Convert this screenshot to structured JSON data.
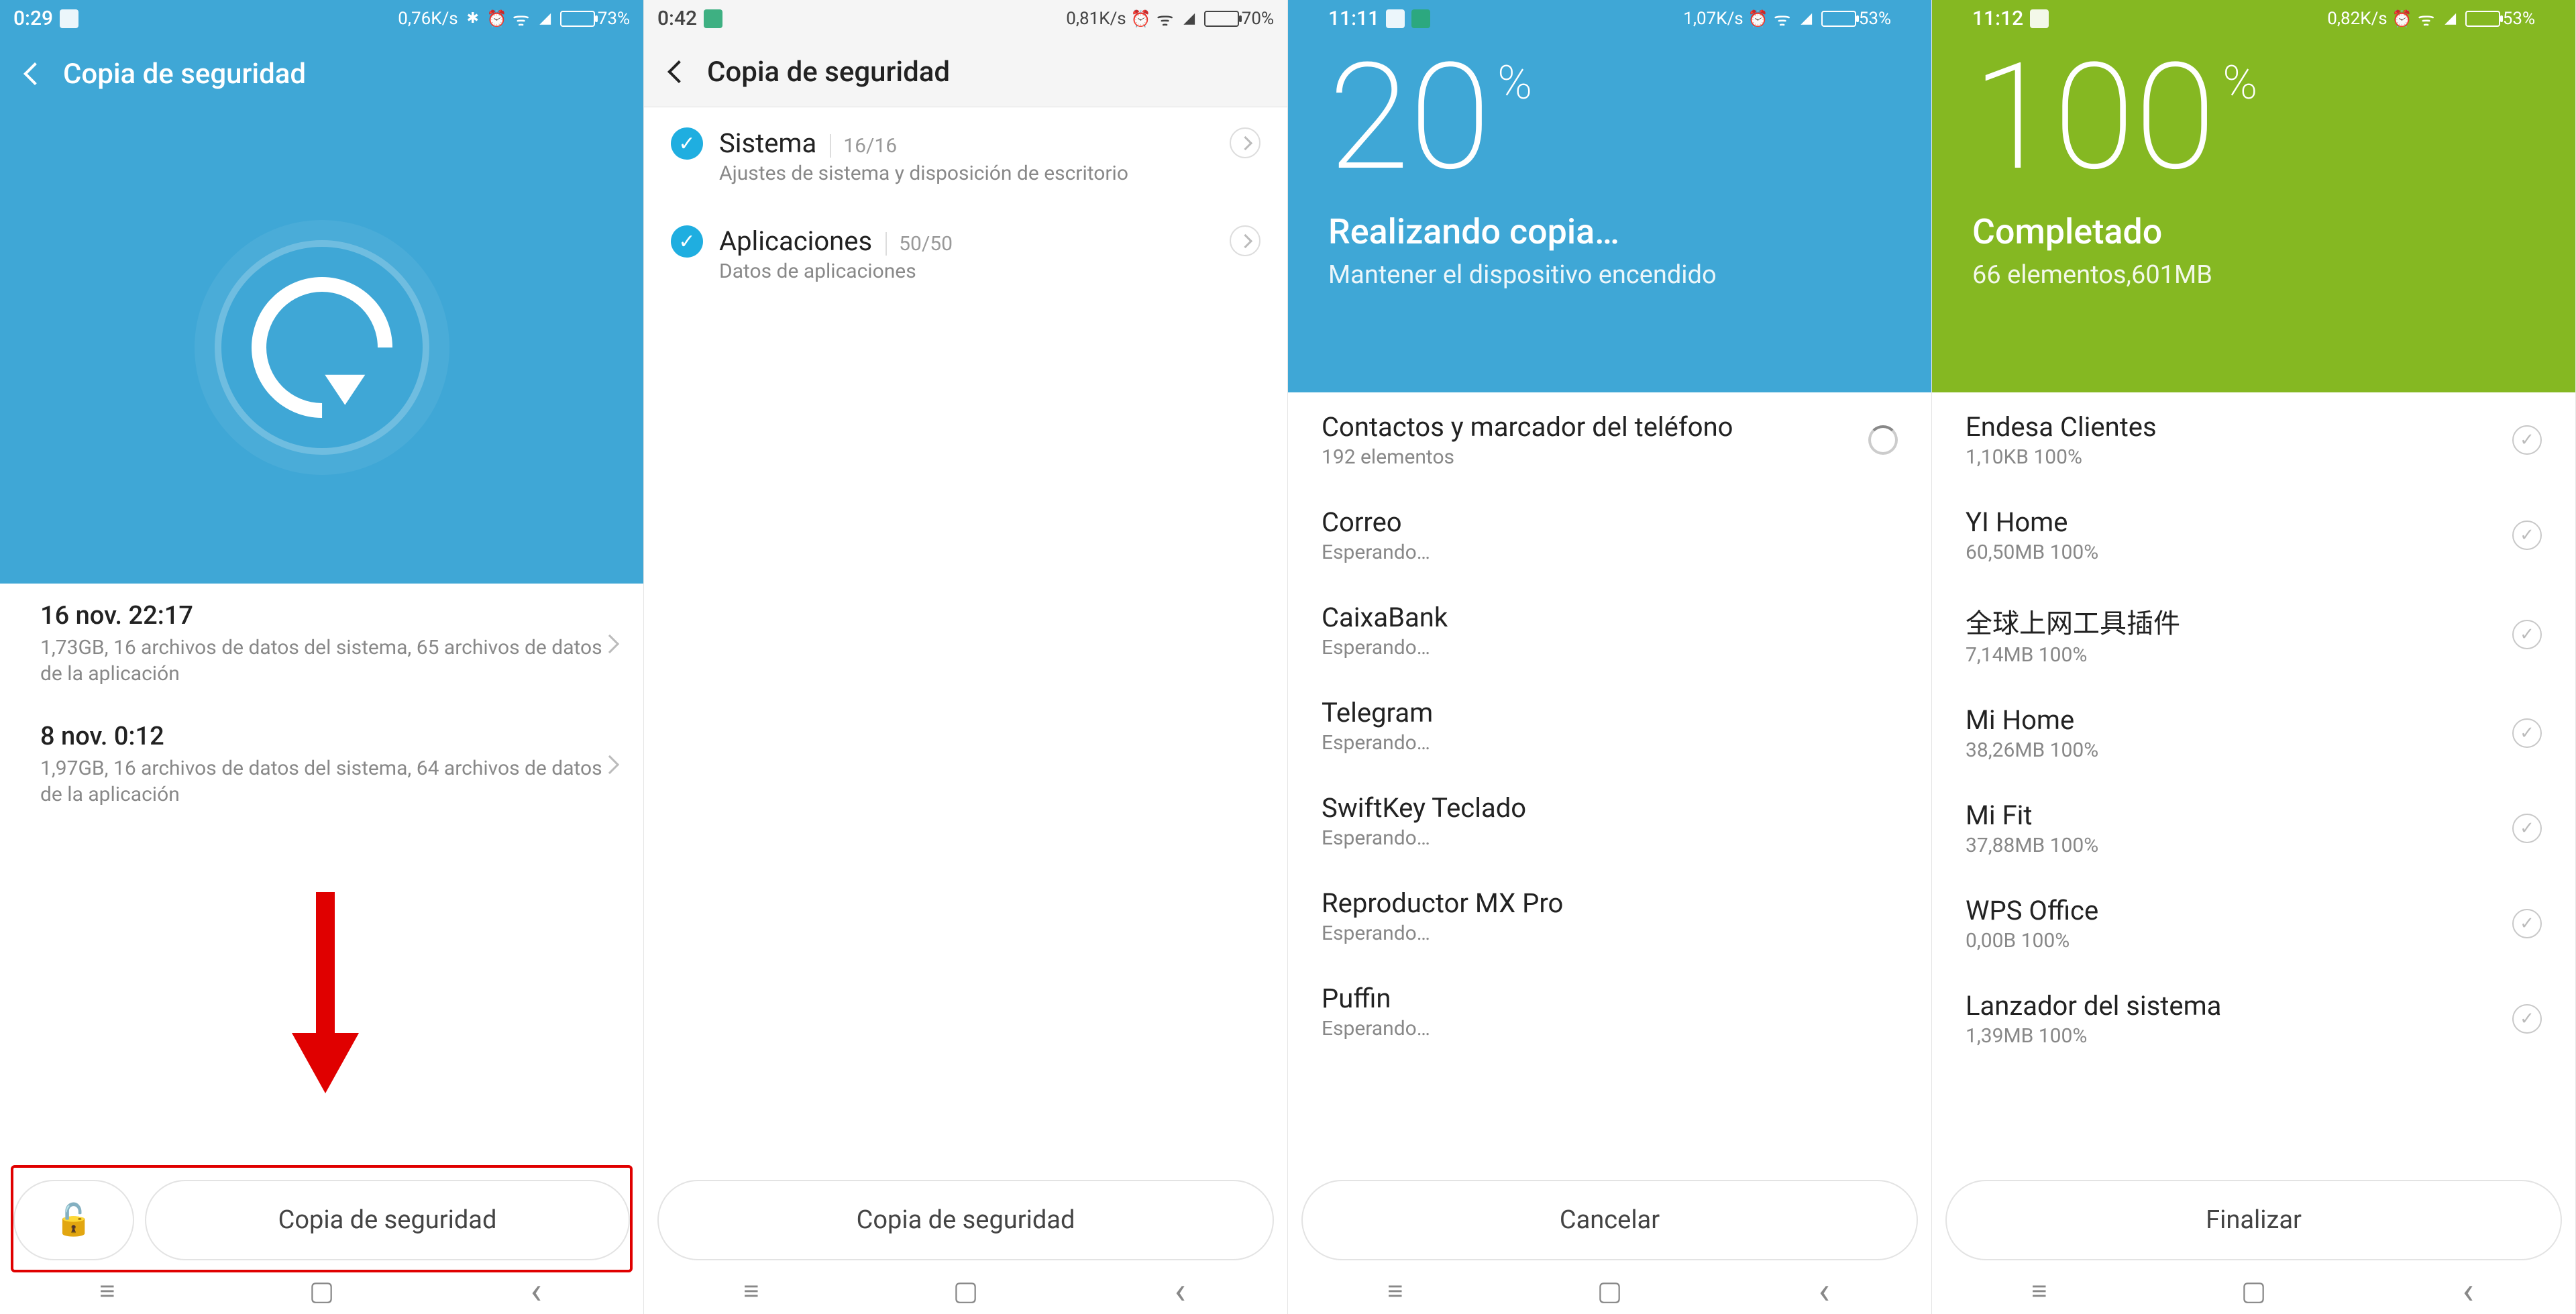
{
  "screen1": {
    "status": {
      "time": "0:29",
      "speed": "0,76K/s",
      "battery_pct": "73%",
      "battery_fill": 73,
      "bluetooth": true
    },
    "header": {
      "title": "Copia de seguridad"
    },
    "backups": [
      {
        "title": "16 nov. 22:17",
        "sub": "1,73GB, 16 archivos de datos del sistema, 65 archivos de datos de la aplicación"
      },
      {
        "title": "8 nov. 0:12",
        "sub": "1,97GB, 16 archivos de datos del sistema, 64 archivos de datos de la aplicación"
      }
    ],
    "primary_button": "Copia de seguridad"
  },
  "screen2": {
    "status": {
      "time": "0:42",
      "speed": "0,81K/s",
      "battery_pct": "70%",
      "battery_fill": 70
    },
    "header": {
      "title": "Copia de seguridad"
    },
    "categories": [
      {
        "title": "Sistema",
        "count": "16/16",
        "sub": "Ajustes de sistema y disposición de escritorio"
      },
      {
        "title": "Aplicaciones",
        "count": "50/50",
        "sub": "Datos de aplicaciones"
      }
    ],
    "primary_button": "Copia de seguridad"
  },
  "screen3": {
    "status": {
      "time": "11:11",
      "speed": "1,07K/s",
      "battery_pct": "53%",
      "battery_fill": 53
    },
    "percent": "20",
    "hero_title": "Realizando copia…",
    "hero_sub": "Mantener el dispositivo encendido",
    "items": [
      {
        "title": "Contactos y marcador del teléfono",
        "sub": "192 elementos",
        "state": "loading"
      },
      {
        "title": "Correo",
        "sub": "Esperando…",
        "state": "wait"
      },
      {
        "title": "CaixaBank",
        "sub": "Esperando…",
        "state": "wait"
      },
      {
        "title": "Telegram",
        "sub": "Esperando…",
        "state": "wait"
      },
      {
        "title": "SwiftKey Teclado",
        "sub": "Esperando…",
        "state": "wait"
      },
      {
        "title": "Reproductor MX Pro",
        "sub": "Esperando…",
        "state": "wait"
      },
      {
        "title": "Puffin",
        "sub": "Esperando…",
        "state": "wait"
      }
    ],
    "primary_button": "Cancelar"
  },
  "screen4": {
    "status": {
      "time": "11:12",
      "speed": "0,82K/s",
      "battery_pct": "53%",
      "battery_fill": 53
    },
    "percent": "100",
    "hero_title": "Completado",
    "hero_sub": "66 elementos,601MB",
    "items": [
      {
        "title": "Endesa Clientes",
        "sub": "1,10KB 100%"
      },
      {
        "title": "YI Home",
        "sub": "60,50MB 100%"
      },
      {
        "title": "全球上网工具插件",
        "sub": "7,14MB 100%"
      },
      {
        "title": "Mi Home",
        "sub": "38,26MB 100%"
      },
      {
        "title": "Mi Fit",
        "sub": "37,88MB 100%"
      },
      {
        "title": "WPS Office",
        "sub": "0,00B 100%"
      },
      {
        "title": "Lanzador del sistema",
        "sub": "1,39MB 100%"
      }
    ],
    "primary_button": "Finalizar"
  },
  "pct_sign": "%"
}
